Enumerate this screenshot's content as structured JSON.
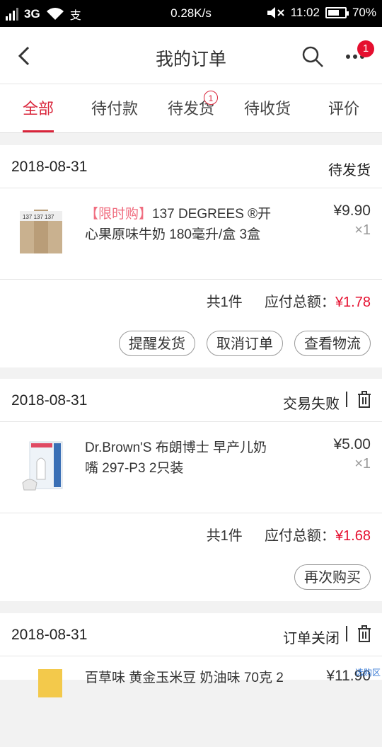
{
  "status_bar": {
    "network": "3G",
    "wifi_icon": "wifi-icon",
    "pay_icon": "alipay-icon",
    "speed": "0.28K/s",
    "mute_icon": "mute-icon",
    "time": "11:02",
    "battery_level": 0.7,
    "battery_text": "70%"
  },
  "header": {
    "title": "我的订单",
    "more_badge": "1"
  },
  "tabs": [
    {
      "label": "全部",
      "active": true
    },
    {
      "label": "待付款"
    },
    {
      "label": "待发货",
      "badge": "1"
    },
    {
      "label": "待收货"
    },
    {
      "label": "评价"
    }
  ],
  "orders": [
    {
      "date": "2018-08-31",
      "status": "待发货",
      "product": {
        "promo_tag": "【限时购】",
        "name": "137 DEGREES ®开心果原味牛奶 180毫升/盒 3盒",
        "price": "¥9.90",
        "qty": "×1"
      },
      "count_text": "共1件",
      "total_label": "应付总额：",
      "total": "¥1.78",
      "buttons": [
        "提醒发货",
        "取消订单",
        "查看物流"
      ]
    },
    {
      "date": "2018-08-31",
      "status": "交易失败",
      "product": {
        "name": "Dr.Brown'S 布朗博士 早产儿奶嘴 297-P3 2只装",
        "price": "¥5.00",
        "qty": "×1"
      },
      "count_text": "共1件",
      "total_label": "应付总额：",
      "total": "¥1.68",
      "buttons": [
        "再次购买"
      ]
    },
    {
      "date": "2018-08-31",
      "status": "订单关闭",
      "product": {
        "name": "百草味 黄金玉米豆 奶油味 70克 2",
        "price": "¥11.90"
      }
    }
  ],
  "watermark": "选购区"
}
